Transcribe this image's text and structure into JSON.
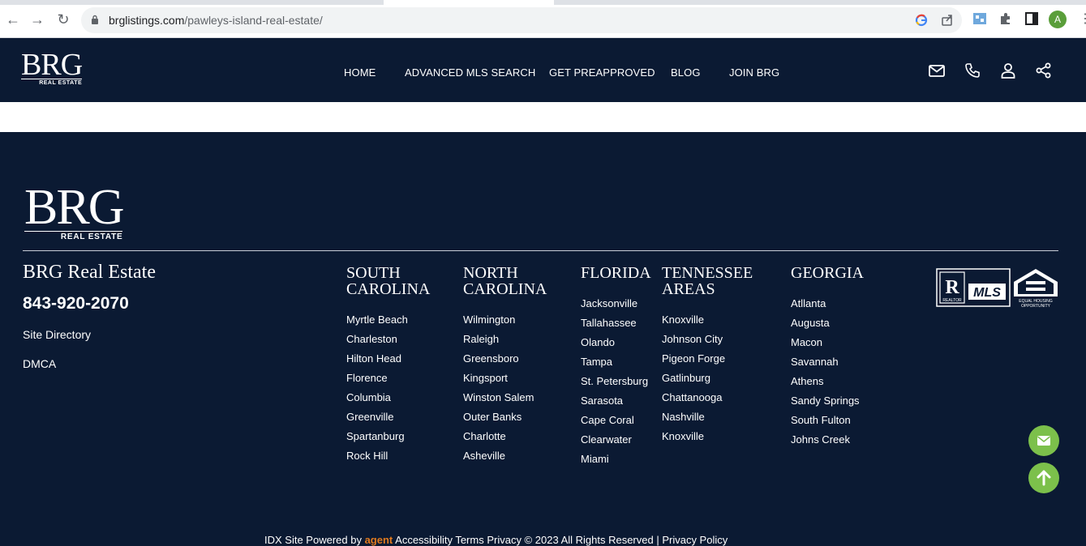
{
  "browser": {
    "url_host": "brglistings.com",
    "url_path": "/pawleys-island-real-estate/",
    "profile_initial": "A"
  },
  "header": {
    "logo_text": "BRG",
    "logo_sub": "REAL ESTATE",
    "nav": [
      "HOME",
      "ADVANCED MLS SEARCH",
      "GET PREAPPROVED",
      "BLOG",
      "JOIN BRG"
    ],
    "icons": [
      "mail-icon",
      "phone-icon",
      "user-icon",
      "share-icon"
    ]
  },
  "footer": {
    "logo_text": "BRG",
    "logo_sub": "REAL ESTATE",
    "company": "BRG Real Estate",
    "phone": "843-920-2070",
    "links": [
      "Site Directory",
      "DMCA"
    ],
    "columns": [
      {
        "title_lines": [
          "SOUTH",
          "CAROLINA"
        ],
        "items": [
          "Myrtle Beach",
          "Charleston",
          "Hilton Head",
          "Florence",
          "Columbia",
          "Greenville",
          "Spartanburg",
          "Rock Hill"
        ]
      },
      {
        "title_lines": [
          "NORTH",
          "CAROLINA"
        ],
        "items": [
          "Wilmington",
          "Raleigh",
          "Greensboro",
          "Kingsport",
          "Winston Salem",
          "Outer Banks",
          "Charlotte",
          "Asheville"
        ]
      },
      {
        "title_lines": [
          "FLORIDA"
        ],
        "items": [
          "Jacksonville",
          "Tallahassee",
          "Olando",
          "Tampa",
          "St. Petersburg",
          "Sarasota",
          "Cape Coral",
          "Clearwater",
          "Miami"
        ]
      },
      {
        "title_lines": [
          "TENNESSEE",
          "AREAS"
        ],
        "items": [
          "Knoxville",
          "Johnson City",
          "Pigeon Forge",
          "Gatlinburg",
          "Chattanooga",
          "Nashville",
          "Knoxville"
        ]
      },
      {
        "title_lines": [
          "GEORGIA"
        ],
        "items": [
          "Atllanta",
          "Augusta",
          "Macon",
          "Savannah",
          "Athens",
          "Sandy Springs",
          "South Fulton",
          "Johns Creek"
        ]
      }
    ],
    "badges": {
      "mls_text": "MLS",
      "realtor_text": "REALTOR",
      "eho_text": "EQUAL HOUSING OPPORTUNITY"
    },
    "bottom_text": {
      "idx": "IDX Site Powered by",
      "brand": "agent",
      "rest": "Accessibility   Terms   Privacy   © 2023 All Rights Reserved | Privacy Policy"
    }
  },
  "colors": {
    "navy": "#0b1a33",
    "green": "#7cc04b"
  }
}
